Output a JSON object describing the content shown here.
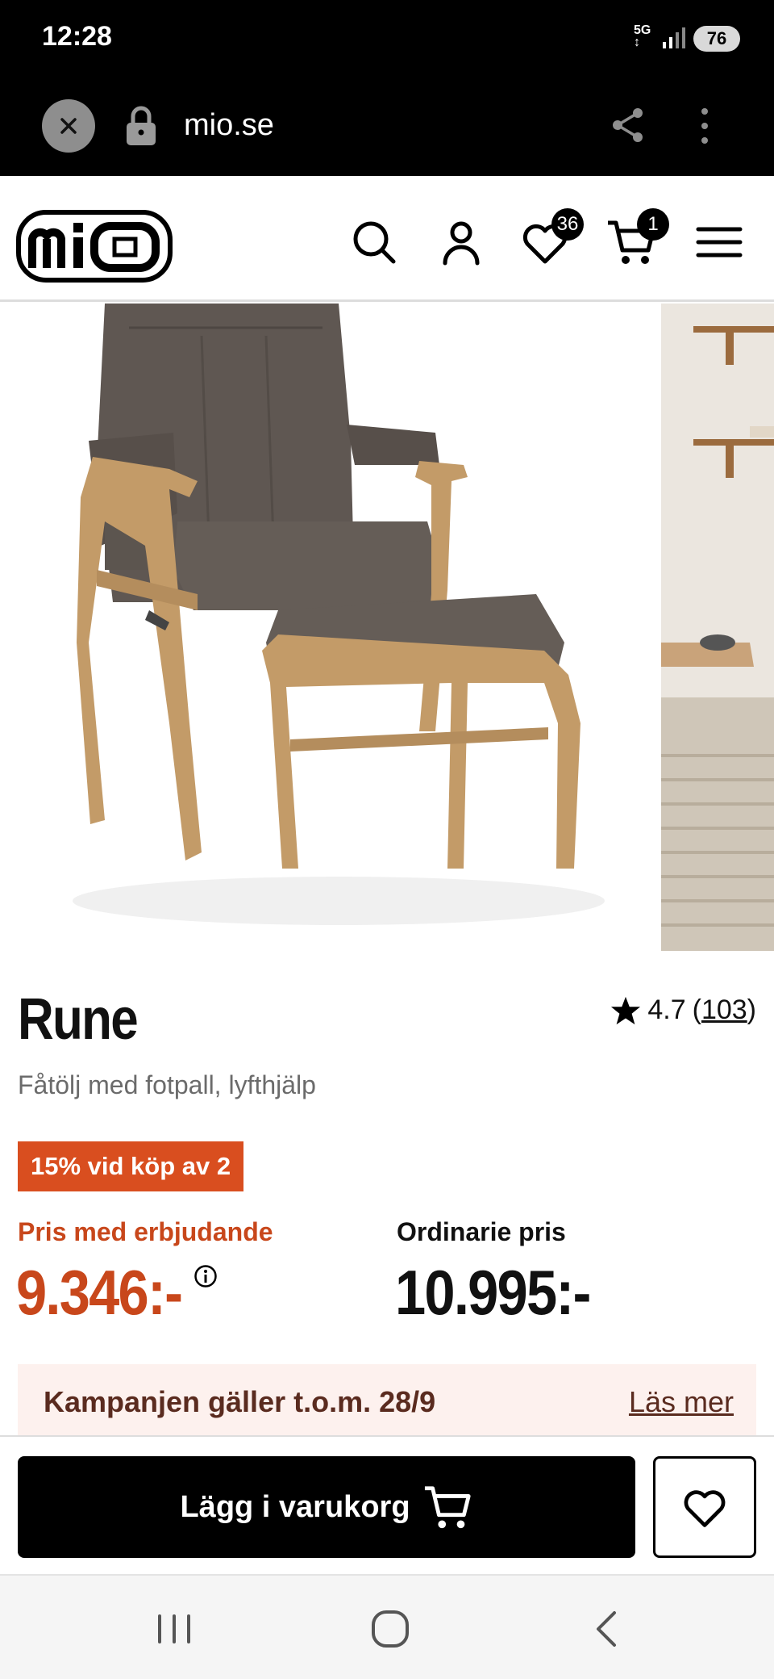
{
  "status_bar": {
    "time": "12:28",
    "network": "5G",
    "battery": "76"
  },
  "browser": {
    "url": "mio.se"
  },
  "header": {
    "logo_text": "mio",
    "wishlist_count": "36",
    "cart_count": "1"
  },
  "product": {
    "title": "Rune",
    "subtitle": "Fåtölj med fotpall, lyfthjälp",
    "rating": "4.7",
    "reviews": "103",
    "promo_badge": "15% vid köp av 2",
    "offer_price_label": "Pris med erbjudande",
    "offer_price": "9.346:-",
    "regular_price_label": "Ordinarie pris",
    "regular_price": "10.995:-"
  },
  "campaign": {
    "text": "Kampanjen gäller t.o.m. 28/9",
    "link": "Läs mer"
  },
  "sticky": {
    "add_to_cart_label": "Lägg i varukorg"
  },
  "colors": {
    "accent": "#d94e1f",
    "price": "#c8471b",
    "campaign_bg": "#fdf1ee"
  }
}
